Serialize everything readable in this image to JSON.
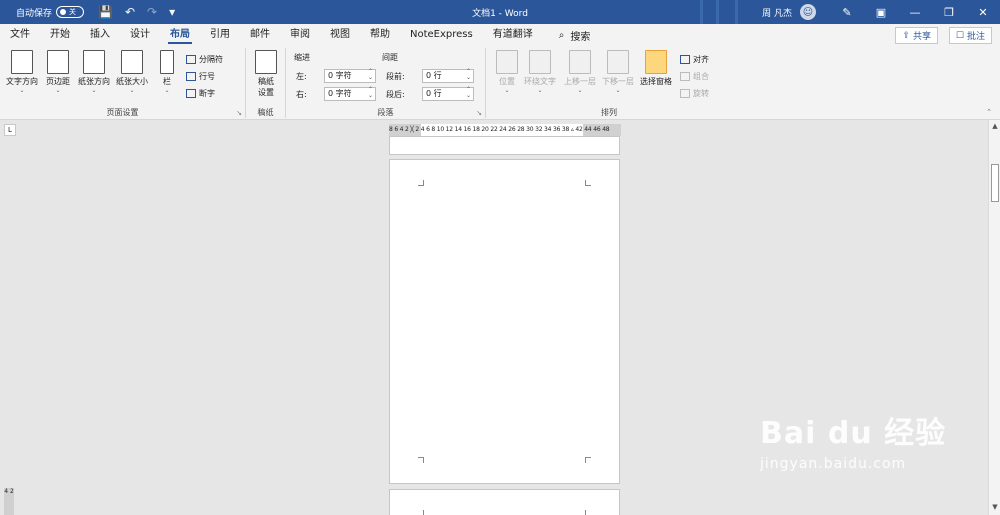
{
  "titlebar": {
    "autosave_label": "自动保存",
    "autosave_state": "关",
    "doc_title": "文档1 - Word",
    "user_name": "周 凡杰",
    "avatar_glyph": "☺",
    "save_icon": "💾",
    "undo_icon": "↶",
    "redo_icon": "↷",
    "qat_more_icon": "▾",
    "pen_icon": "✎",
    "display_icon": "▣",
    "min_icon": "—",
    "restore_icon": "❐",
    "close_icon": "✕"
  },
  "tabs": [
    "文件",
    "开始",
    "插入",
    "设计",
    "布局",
    "引用",
    "邮件",
    "审阅",
    "视图",
    "帮助",
    "NoteExpress",
    "有道翻译"
  ],
  "active_tab": "布局",
  "search": {
    "icon": "⌕",
    "label": "搜索"
  },
  "share": {
    "icon": "⇪",
    "label": "共享"
  },
  "comment": {
    "icon": "☐",
    "label": "批注"
  },
  "groups": {
    "page_setup": {
      "label": "页面设置",
      "text_direction": "文字方向",
      "margins": "页边距",
      "orientation": "纸张方向",
      "size": "纸张大小",
      "columns": "栏",
      "breaks": "分隔符",
      "line_numbers": "行号",
      "hyphenation": "断字"
    },
    "draft": {
      "label": "稿纸",
      "btn_line1": "稿纸",
      "btn_line2": "设置"
    },
    "paragraph": {
      "label": "段落",
      "indent_title": "缩进",
      "spacing_title": "间距",
      "left_label": "左:",
      "right_label": "右:",
      "before_label": "段前:",
      "after_label": "段后:",
      "left_value": "0 字符",
      "right_value": "0 字符",
      "before_value": "0 行",
      "after_value": "0 行"
    },
    "arrange": {
      "label": "排列",
      "position": "位置",
      "wrap_text": "环绕文字",
      "bring_forward": "上移一层",
      "send_backward": "下移一层",
      "selection_pane": "选择窗格",
      "align": "对齐",
      "group": "组合",
      "rotate": "旋转"
    }
  },
  "ruler": {
    "corner": "L",
    "text": "8  6  4  2  ╳  2  4  6  8 10 12 14 16 18 20 22 24 26 28 30 32 34 36 38 ▵ 42 44 46 48",
    "vertical_text": "4 2"
  },
  "watermark": {
    "logo": "Bai du 经验",
    "url": "jingyan.baidu.com"
  },
  "colors": {
    "title_bar": "#2b579a",
    "ribbon": "#f3f3f3",
    "canvas": "#e6e6e6",
    "accent": "#2b579a"
  }
}
